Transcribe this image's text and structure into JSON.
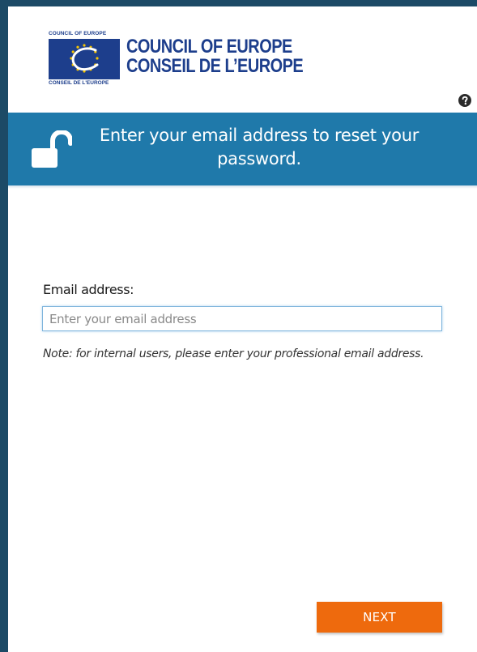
{
  "logo": {
    "small_top": "COUNCIL OF EUROPE",
    "small_bottom": "CONSEIL DE L'EUROPE",
    "line1": "COUNCIL OF EUROPE",
    "line2": "CONSEIL DE L’EUROPE"
  },
  "colors": {
    "frame": "#1c4a66",
    "banner": "#1f79aa",
    "brand_blue": "#1d3e8c",
    "button": "#ee6a0d",
    "input_border": "#7fb5dc"
  },
  "banner": {
    "icon": "unlock-icon",
    "text": "Enter your email address to reset your password."
  },
  "help": {
    "icon": "question-circle-icon"
  },
  "form": {
    "email_label": "Email address:",
    "email_placeholder": "Enter your email address",
    "email_value": "",
    "note": "Note: for internal users, please enter your professional email address."
  },
  "actions": {
    "next_label": "NEXT"
  }
}
